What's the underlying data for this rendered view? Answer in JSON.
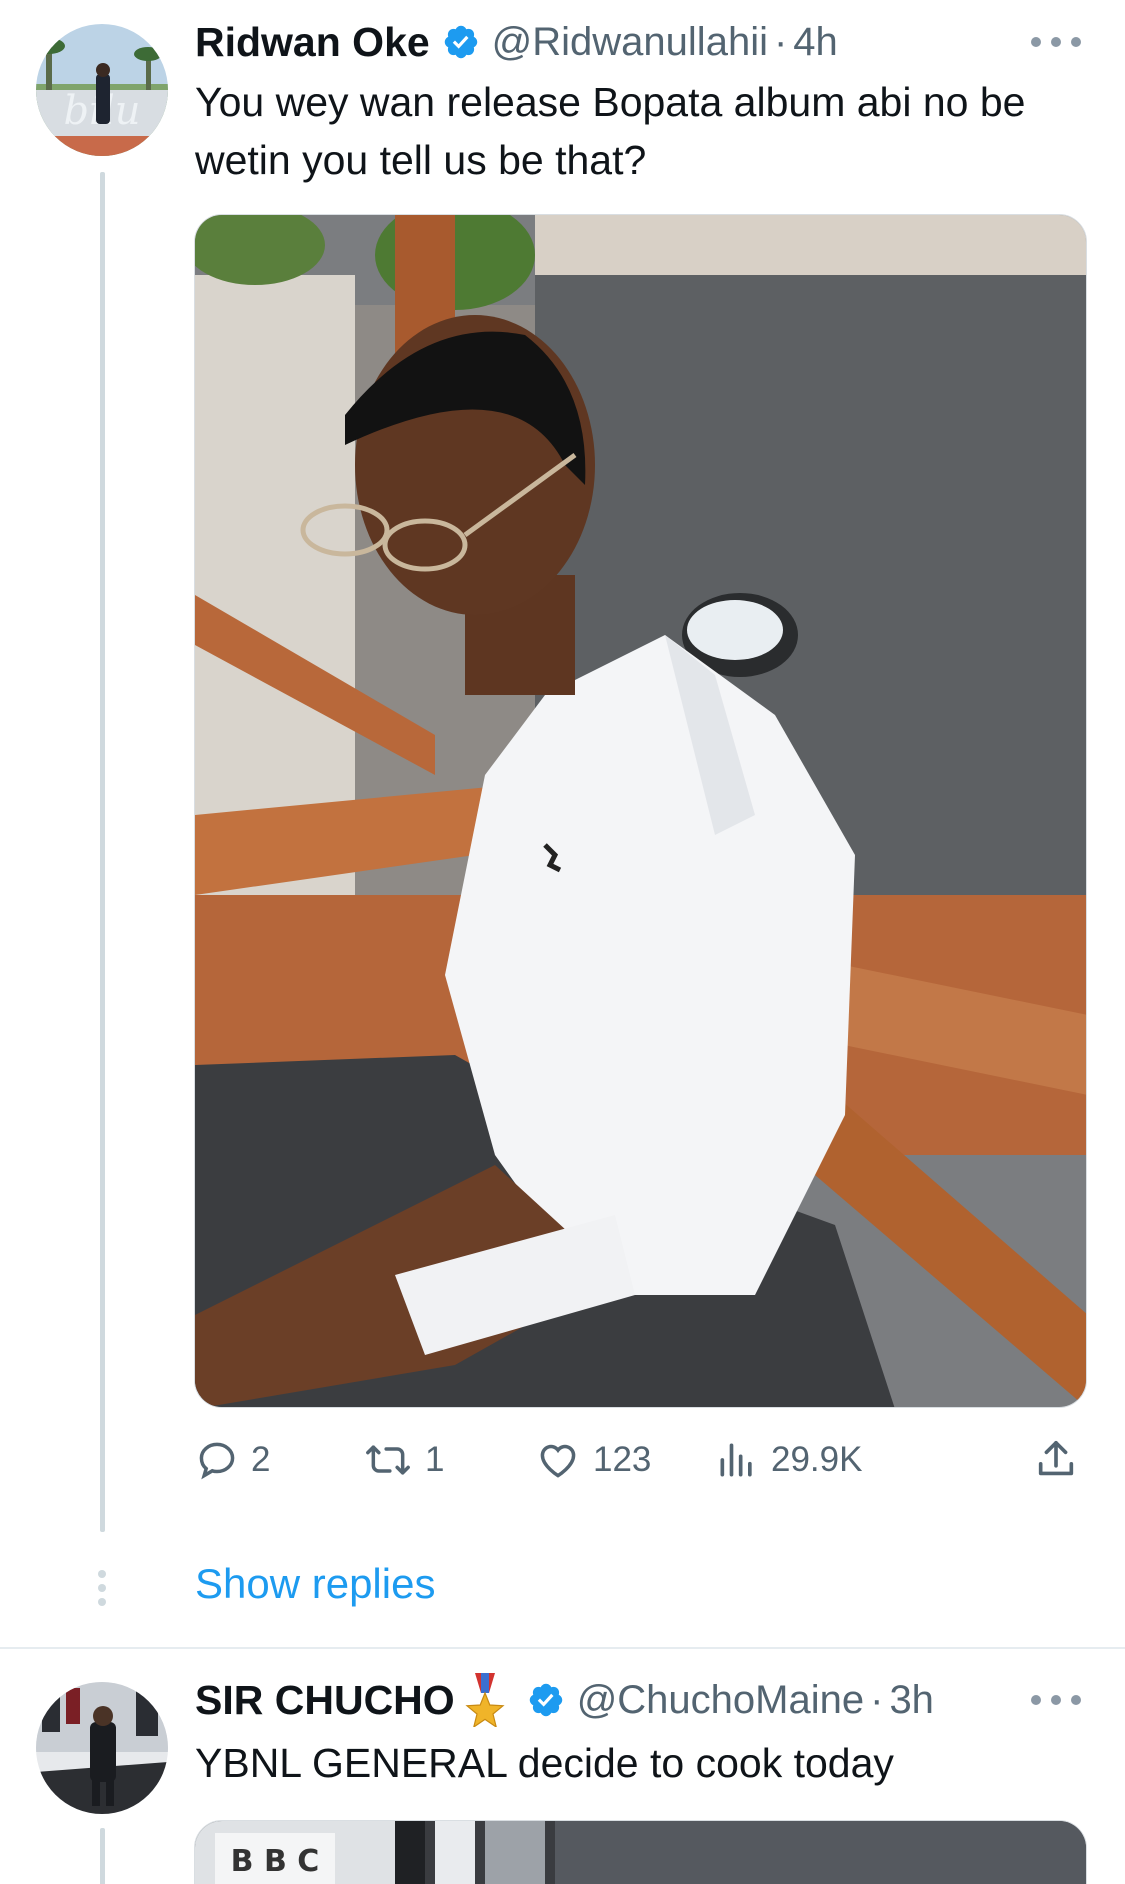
{
  "tweets": [
    {
      "author_name": "Ridwan Oke",
      "handle": "@Ridwanullahii",
      "separator": "·",
      "time": "4h",
      "text": "You wey wan release Bopata album abi no be wetin you tell us be that?",
      "avatar_text": "bilu",
      "stats": {
        "replies": "2",
        "retweets": "1",
        "likes": "123",
        "views": "29.9K"
      },
      "show_replies_label": "Show replies"
    },
    {
      "author_name": "SIR CHUCHO",
      "handle": "@ChuchoMaine",
      "separator": "·",
      "time": "3h",
      "text": "YBNL GENERAL decide to cook today",
      "media_text": "B B C"
    }
  ],
  "colors": {
    "link_blue": "#1d9bf0",
    "verified_blue": "#1d9bf0",
    "text_primary": "#0f1419",
    "text_secondary": "#536471",
    "thread_line": "#cfd9de"
  },
  "icons": [
    "verified-badge-icon",
    "more-options-icon",
    "reply-icon",
    "retweet-icon",
    "like-icon",
    "views-icon",
    "share-icon",
    "medal-icon"
  ]
}
